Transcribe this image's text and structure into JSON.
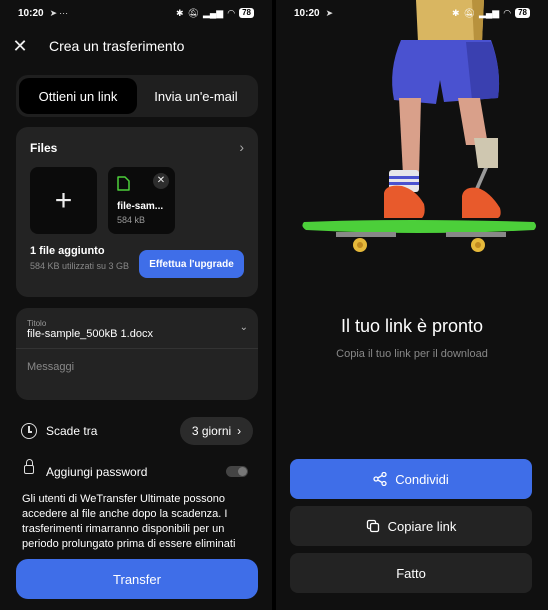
{
  "status_bar": {
    "left_time": "10:20",
    "right_time": "10:20",
    "battery": "78"
  },
  "left": {
    "header_title": "Crea un trasferimento",
    "tabs": [
      {
        "label": "Ottieni un link",
        "active": true
      },
      {
        "label": "Invia un'e-mail",
        "active": false
      }
    ],
    "files": {
      "title": "Files",
      "file_name": "file-sam...",
      "file_size": "584 kB",
      "added_count": "1 file aggiunto",
      "storage_info": "584 KB utilizzati su 3 GB",
      "upgrade_label": "Effettua l'upgrade"
    },
    "form": {
      "title_label": "Titolo",
      "title_value": "file-sample_500kB 1.docx",
      "message_placeholder": "Messaggi"
    },
    "expiry": {
      "label": "Scade tra",
      "value": "3 giorni"
    },
    "password": {
      "label": "Aggiungi password",
      "enabled": false
    },
    "info_text": "Gli utenti di WeTransfer Ultimate possono accedere al file anche dopo la scadenza. I trasferimenti rimarranno disponibili per un periodo prolungato prima di essere eliminati",
    "transfer_label": "Transfer"
  },
  "right": {
    "title": "Il tuo link è pronto",
    "subtitle": "Copia il tuo link per il download",
    "share_label": "Condividi",
    "copy_label": "Copiare link",
    "done_label": "Fatto"
  },
  "colors": {
    "accent": "#3f6ee8",
    "background": "#101010",
    "card": "#232323",
    "skateboard": "#4ccf3a"
  }
}
